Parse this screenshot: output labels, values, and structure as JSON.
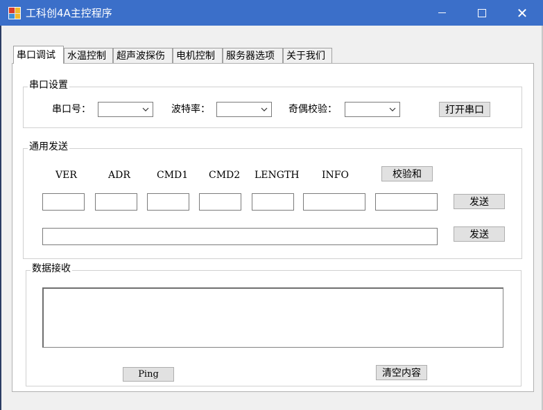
{
  "window": {
    "title": "工科创4A主控程序",
    "controls": {
      "close": "✕"
    }
  },
  "tabs": [
    {
      "label": "串口调试",
      "active": true
    },
    {
      "label": "水温控制",
      "active": false
    },
    {
      "label": "超声波探伤",
      "active": false
    },
    {
      "label": "电机控制",
      "active": false
    },
    {
      "label": "服务器选项",
      "active": false
    },
    {
      "label": "关于我们",
      "active": false
    }
  ],
  "serial_settings": {
    "legend": "串口设置",
    "port_label": "串口号：",
    "baud_label": "波特率：",
    "parity_label": "奇偶校验：",
    "open_button": "打开串口",
    "port_value": "",
    "baud_value": "",
    "parity_value": ""
  },
  "general_send": {
    "legend": "通用发送",
    "columns": [
      "VER",
      "ADR",
      "CMD1",
      "CMD2",
      "LENGTH",
      "INFO"
    ],
    "checksum_button": "校验和",
    "send_button_1": "发送",
    "send_button_2": "发送",
    "fields": [
      "",
      "",
      "",
      "",
      "",
      "",
      ""
    ],
    "raw_value": ""
  },
  "data_receive": {
    "legend": "数据接收",
    "content": "",
    "ping_button": "Ping",
    "clear_button": "清空内容"
  },
  "colors": {
    "titlebar": "#3b6fc9",
    "window_bg": "#f0f0f0",
    "panel_bg": "#ffffff",
    "button_bg": "#e1e1e1"
  }
}
